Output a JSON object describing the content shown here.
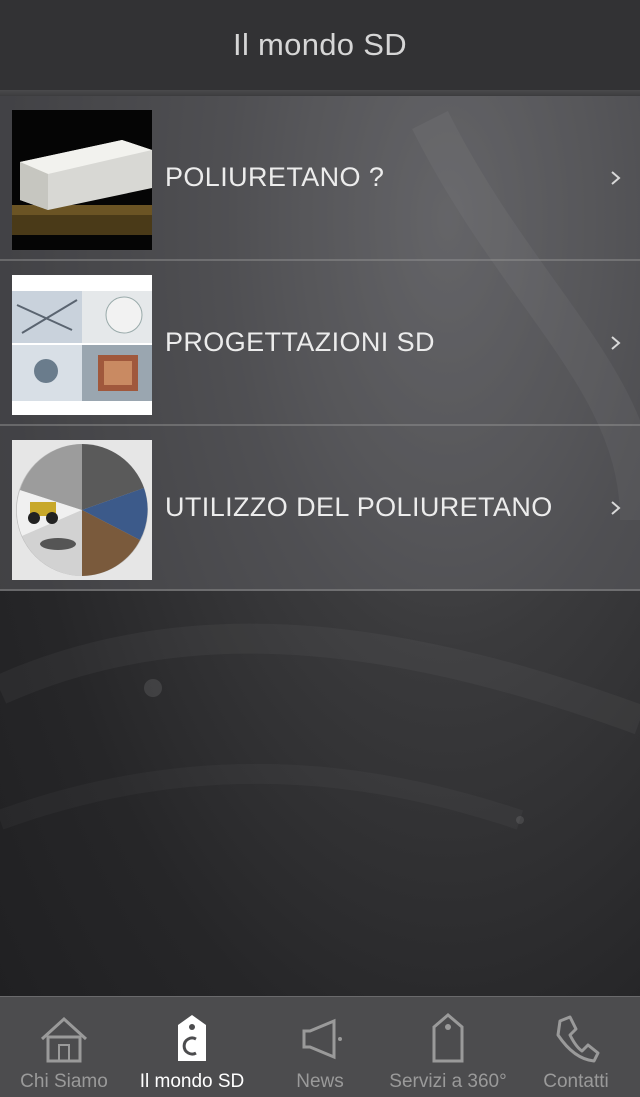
{
  "header": {
    "title": "Il mondo SD"
  },
  "list": {
    "items": [
      {
        "label": "POLIURETANO ?",
        "thumbnail": "foam-block-image"
      },
      {
        "label": "PROGETTAZIONI SD",
        "thumbnail": "design-collage-image"
      },
      {
        "label": "UTILIZZO DEL POLIURETANO",
        "thumbnail": "applications-collage-image"
      }
    ]
  },
  "tabbar": {
    "active_index": 1,
    "tabs": [
      {
        "label": "Chi Siamo",
        "icon": "home-icon"
      },
      {
        "label": "Il mondo SD",
        "icon": "tag-icon"
      },
      {
        "label": "News",
        "icon": "megaphone-icon"
      },
      {
        "label": "Servizi a 360°",
        "icon": "tag-outline-icon"
      },
      {
        "label": "Contatti",
        "icon": "phone-icon"
      }
    ]
  },
  "colors": {
    "navbar": "#323234",
    "tabbar": "#4c4c4e",
    "active_tab": "#ffffff",
    "inactive_tab": "#9a9a9a"
  }
}
